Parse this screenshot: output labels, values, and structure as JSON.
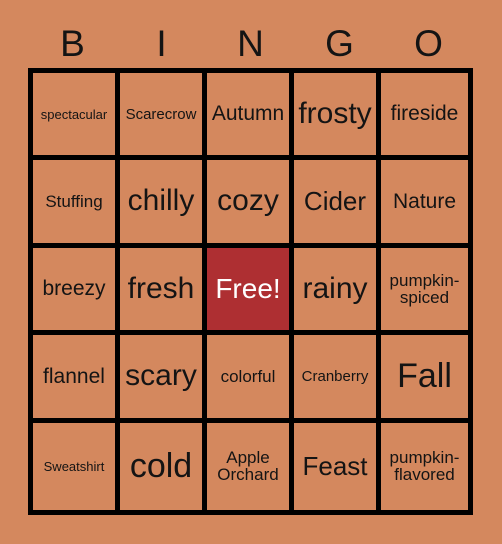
{
  "card": {
    "background_color": "#d4885e",
    "border_color": "#000000",
    "text_color": "#141414",
    "free_cell_color": "#ae2f32",
    "free_cell_text_color": "#ffffff"
  },
  "header": {
    "letters": [
      "B",
      "I",
      "N",
      "G",
      "O"
    ]
  },
  "grid": {
    "rows": 5,
    "columns": 5,
    "cells": [
      [
        {
          "label": "spectacular",
          "size": "fs-xs",
          "free": false
        },
        {
          "label": "Scarecrow",
          "size": "fs-sm",
          "free": false
        },
        {
          "label": "Autumn",
          "size": "fs-lg",
          "free": false
        },
        {
          "label": "frosty",
          "size": "fs-xxl",
          "free": false
        },
        {
          "label": "fireside",
          "size": "fs-lg",
          "free": false
        }
      ],
      [
        {
          "label": "Stuffing",
          "size": "fs-md",
          "free": false
        },
        {
          "label": "chilly",
          "size": "fs-xxl",
          "free": false
        },
        {
          "label": "cozy",
          "size": "fs-xxl",
          "free": false
        },
        {
          "label": "Cider",
          "size": "fs-xl",
          "free": false
        },
        {
          "label": "Nature",
          "size": "fs-lg",
          "free": false
        }
      ],
      [
        {
          "label": "breezy",
          "size": "fs-lg",
          "free": false
        },
        {
          "label": "fresh",
          "size": "fs-xxl",
          "free": false
        },
        {
          "label": "Free!",
          "size": "fs-xl",
          "free": true
        },
        {
          "label": "rainy",
          "size": "fs-xxl",
          "free": false
        },
        {
          "label": "pumpkin-spiced",
          "size": "fs-md",
          "free": false
        }
      ],
      [
        {
          "label": "flannel",
          "size": "fs-lg",
          "free": false
        },
        {
          "label": "scary",
          "size": "fs-xxl",
          "free": false
        },
        {
          "label": "colorful",
          "size": "fs-md",
          "free": false
        },
        {
          "label": "Cranberry",
          "size": "fs-sm",
          "free": false
        },
        {
          "label": "Fall",
          "size": "fs-max",
          "free": false
        }
      ],
      [
        {
          "label": "Sweatshirt",
          "size": "fs-xs",
          "free": false
        },
        {
          "label": "cold",
          "size": "fs-max",
          "free": false
        },
        {
          "label": "Apple Orchard",
          "size": "fs-md",
          "free": false
        },
        {
          "label": "Feast",
          "size": "fs-xl",
          "free": false
        },
        {
          "label": "pumpkin-flavored",
          "size": "fs-md",
          "free": false
        }
      ]
    ]
  }
}
